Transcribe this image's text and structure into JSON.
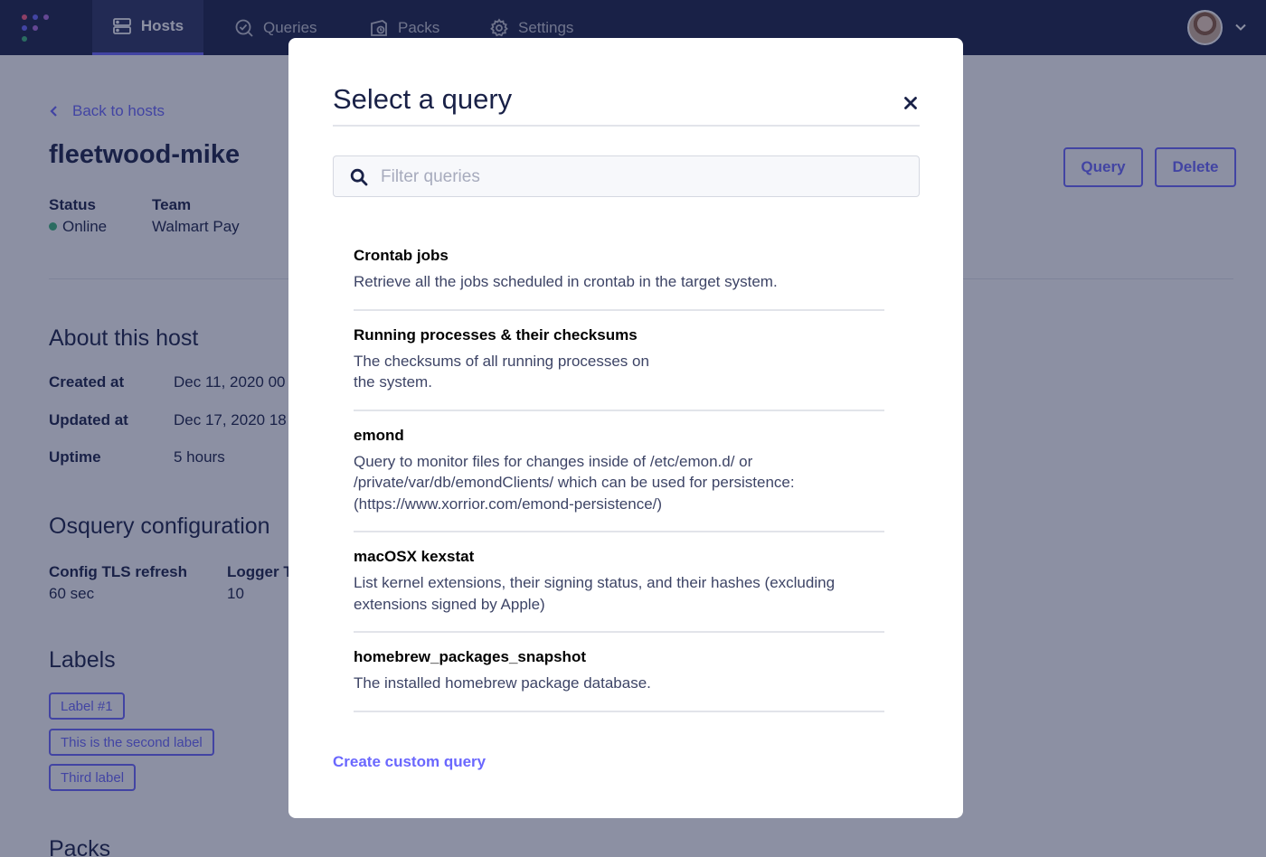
{
  "nav": {
    "items": [
      {
        "label": "Hosts",
        "icon": "server-icon",
        "active": true
      },
      {
        "label": "Queries",
        "icon": "search-check-icon",
        "active": false
      },
      {
        "label": "Packs",
        "icon": "packs-icon",
        "active": false
      },
      {
        "label": "Settings",
        "icon": "gear-icon",
        "active": false
      }
    ]
  },
  "host": {
    "back_label": "Back to hosts",
    "name": "fleetwood-mike",
    "status_label": "Status",
    "status_value": "Online",
    "team_label": "Team",
    "team_value": "Walmart Pay",
    "query_button": "Query",
    "delete_button": "Delete",
    "about_title": "About this host",
    "about": [
      {
        "label": "Created at",
        "value": "Dec 11, 2020 00"
      },
      {
        "label": "Updated at",
        "value": "Dec 17, 2020 18"
      },
      {
        "label": "Uptime",
        "value": "5 hours"
      }
    ],
    "osquery_title": "Osquery configuration",
    "config": [
      {
        "label": "Config TLS refresh",
        "value": "60 sec"
      },
      {
        "label": "Logger T",
        "value": "10"
      }
    ],
    "labels_title": "Labels",
    "labels": [
      "Label #1",
      "This is the second label",
      "Third label"
    ],
    "packs_title": "Packs"
  },
  "modal": {
    "title": "Select a query",
    "search_placeholder": "Filter queries",
    "queries": [
      {
        "name": "Crontab jobs",
        "description": "Retrieve all the jobs scheduled in crontab in the target system."
      },
      {
        "name": "Running processes & their checksums",
        "description_lines": [
          "The checksums of all running processes on",
          "the system."
        ]
      },
      {
        "name": "emond",
        "description_lines": [
          "Query to monitor files for changes inside of /etc/emon.d/ or",
          "/private/var/db/emondClients/ which can be used for persistence:",
          "(https://www.xorrior.com/emond-persistence/)"
        ]
      },
      {
        "name": "macOSX kexstat",
        "description_lines": [
          "List kernel extensions, their signing status, and their hashes (excluding",
          "extensions signed by Apple)"
        ]
      },
      {
        "name": "homebrew_packages_snapshot",
        "description": "The installed homebrew package database."
      }
    ],
    "create_link": "Create custom query"
  },
  "colors": {
    "nav_bg": "#192147",
    "accent": "#6a67fe",
    "online": "#3db67b"
  }
}
